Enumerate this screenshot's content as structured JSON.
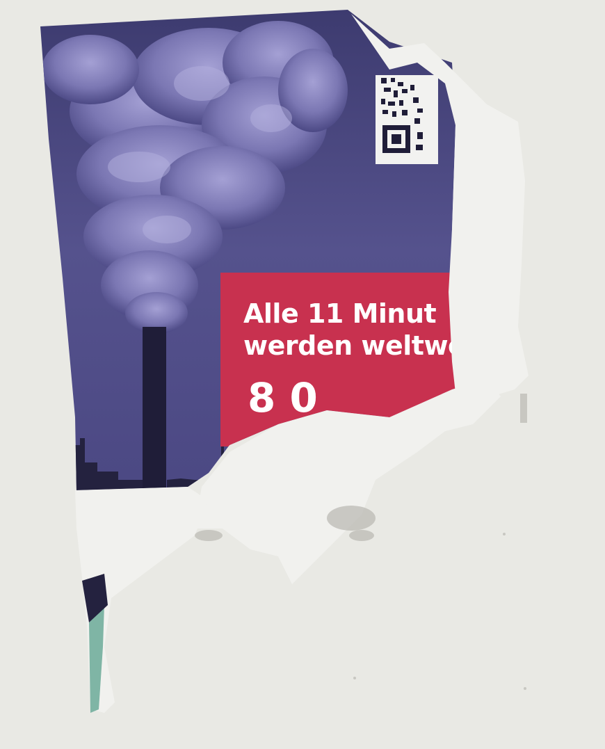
{
  "poster": {
    "headline_line1": "Alle 11 Minut",
    "headline_line2": "werden weltwe",
    "big_number_fragment": "8  0"
  },
  "colors": {
    "wall": "#e9e9e4",
    "sky": "#4f4c86",
    "smoke": "#8c88c0",
    "banner_red": "#c8314f",
    "torn_paper": "#f1f1ee",
    "teal_strip": "#7fb5a5"
  },
  "icons": [
    "qr-code-icon"
  ]
}
